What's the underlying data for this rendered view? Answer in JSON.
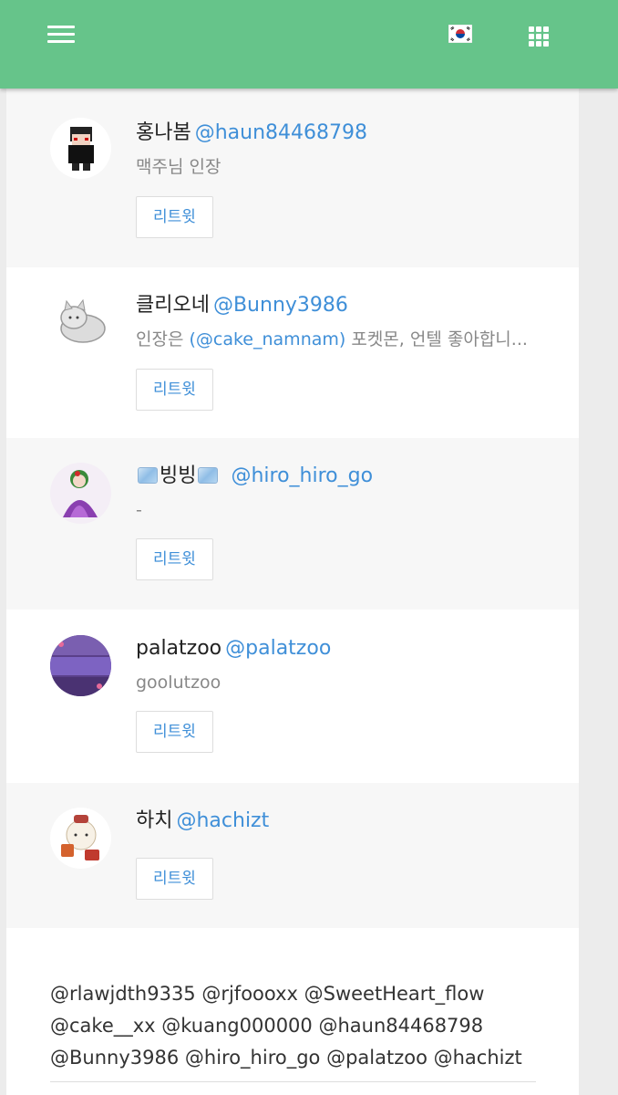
{
  "header": {
    "background": "#66c48a",
    "menu_icon": "hamburger-menu-icon",
    "flag_icon": "korea-flag-icon",
    "apps_icon": "grid-apps-icon"
  },
  "users": [
    {
      "name": "홍나봄",
      "handle": "@haun84468798",
      "bio": "맥주님 인장",
      "retweet_label": "리트윗"
    },
    {
      "name": "클리오네",
      "handle": "@Bunny3986",
      "bio_prefix": "인장은 ",
      "bio_mention": "(@cake_namnam)",
      "bio_suffix": " 포켓몬, 언텔 좋아합니...",
      "retweet_label": "리트윗"
    },
    {
      "name": "빙빙",
      "handle": "@hiro_hiro_go",
      "bio": "-",
      "retweet_label": "리트윗"
    },
    {
      "name": "palatzoo",
      "handle": "@palatzoo",
      "bio": "goolutzoo",
      "retweet_label": "리트윗"
    },
    {
      "name": "하치",
      "handle": "@hachizt",
      "retweet_label": "리트윗"
    }
  ],
  "summary": "@rlawjdth9335 @rjfoooxx @SweetHeart_flow @cake__xx @kuang000000 @haun84468798 @Bunny3986 @hiro_hiro_go @palatzoo @hachizt",
  "colors": {
    "link": "#3f8fd8",
    "muted": "#888888",
    "alt_row": "#f7f7f7"
  }
}
